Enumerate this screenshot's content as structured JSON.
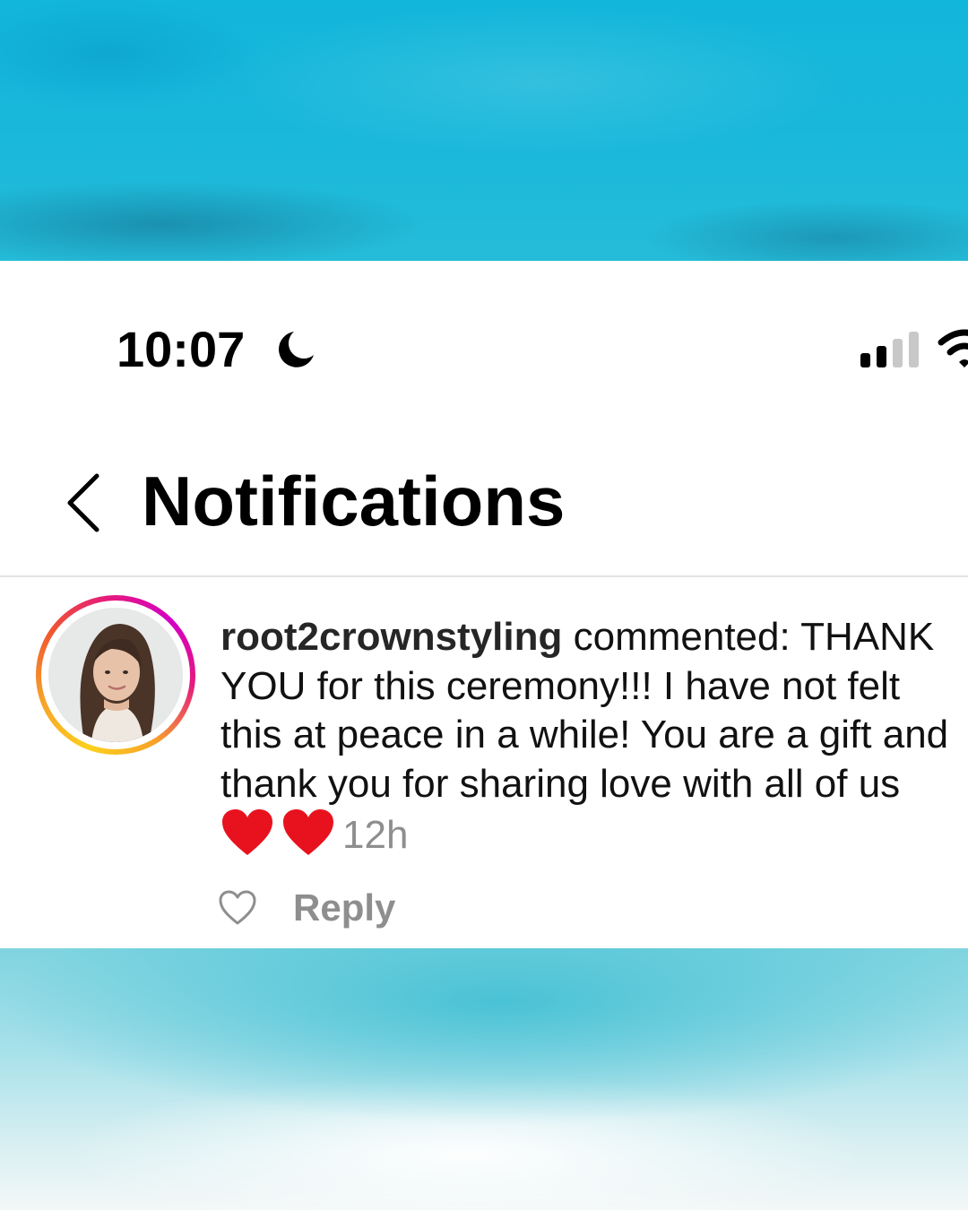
{
  "status_bar": {
    "time": "10:07",
    "icons": [
      "moon-icon",
      "signal-icon",
      "wifi-icon"
    ]
  },
  "header": {
    "back_icon": "chevron-left-icon",
    "title": "Notifications"
  },
  "notification": {
    "username": "root2crownstyling",
    "action": " commented:",
    "comment_text": "THANK YOU for this ceremony!!! I have not felt this at peace in a while! You are a gift and thank you for sharing love with all of us",
    "emojis": [
      "red-heart",
      "red-heart"
    ],
    "timestamp": "12h",
    "avatar_ring_colors": [
      "#fdd01c",
      "#f0582f",
      "#d300c5"
    ],
    "like_icon": "heart-outline-icon",
    "reply_label": "Reply"
  },
  "colors": {
    "ocean": "#1ab8db",
    "muted_text": "#8e8e8e",
    "heart": "#e8121e"
  }
}
